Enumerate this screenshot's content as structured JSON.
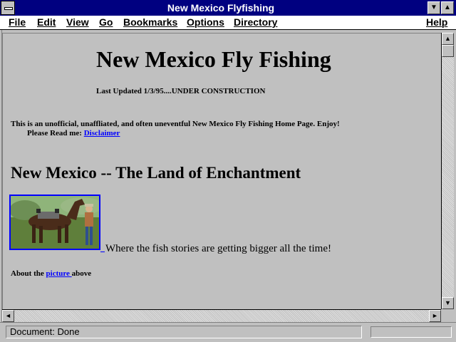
{
  "window": {
    "title": "New Mexico Flyfishing",
    "minimize_glyph": "▼",
    "maximize_glyph": "▲"
  },
  "menu": {
    "items": [
      "File",
      "Edit",
      "View",
      "Go",
      "Bookmarks",
      "Options",
      "Directory"
    ],
    "help": "Help"
  },
  "page": {
    "heading": "New Mexico Fly Fishing",
    "last_updated": "Last Updated 1/3/95....UNDER CONSTRUCTION",
    "intro": "This is an unofficial, unaffliated, and often uneventful New Mexico Fly Fishing Home Page.  Enjoy!",
    "read_me_label": "Please Read me:",
    "disclaimer_link": " Disclaimer",
    "subheading": "New Mexico -- The Land of Enchantment",
    "caption": "Where the fish stories are getting bigger all the time!",
    "about_prefix": "About the",
    "picture_link": "picture ",
    "about_suffix": "above"
  },
  "scrollbars": {
    "up_glyph": "▲",
    "down_glyph": "▼",
    "left_glyph": "◄",
    "right_glyph": "►"
  },
  "status": {
    "text": "Document: Done"
  },
  "colors": {
    "titlebar": "#000080",
    "link": "#0000ff",
    "background": "#c0c0c0"
  }
}
